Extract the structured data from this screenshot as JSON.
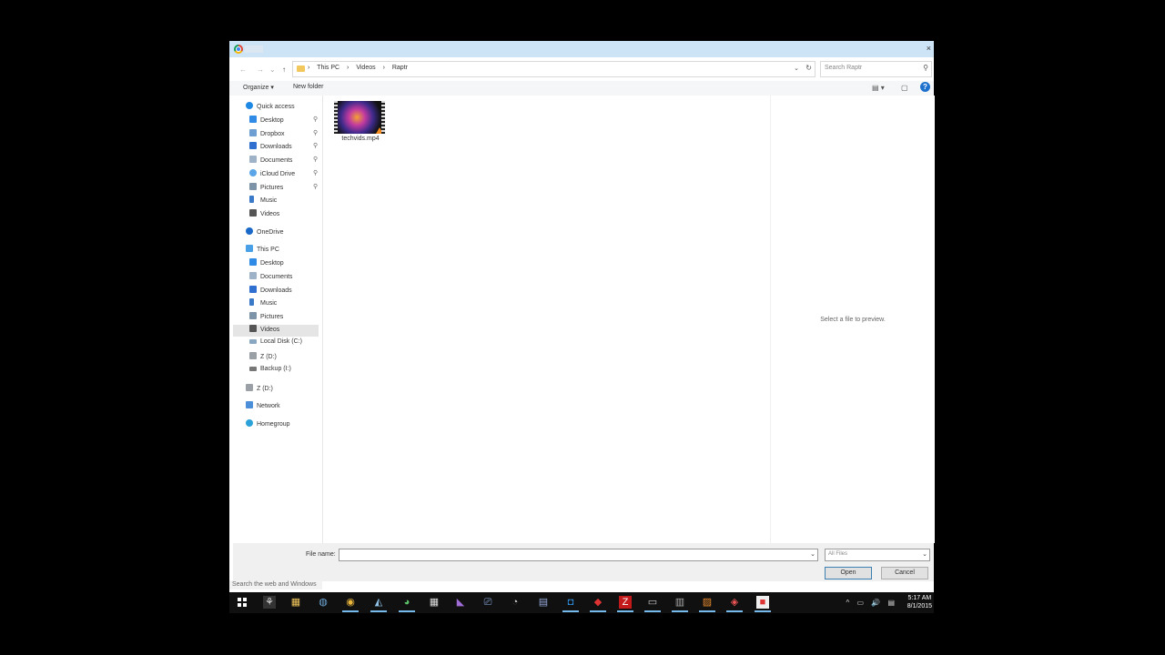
{
  "window": {
    "close_symbol": "×"
  },
  "address": {
    "back": "←",
    "forward": "→",
    "recent": "⌄",
    "up": "↑",
    "crumbs": [
      "›",
      "This PC",
      "›",
      "Videos",
      "›",
      "Raptr"
    ],
    "search_placeholder": "Search Raptr"
  },
  "toolbar": {
    "organize": "Organize ▾",
    "new_folder": "New folder",
    "help": "?"
  },
  "nav": {
    "quick_access": "Quick access",
    "qa_items": [
      "Desktop",
      "Dropbox",
      "Downloads",
      "Documents",
      "iCloud Drive",
      "Pictures",
      "Music",
      "Videos"
    ],
    "onedrive": "OneDrive",
    "this_pc": "This PC",
    "pc_items": [
      "Desktop",
      "Documents",
      "Downloads",
      "Music",
      "Pictures",
      "Videos",
      "Local Disk (C:)",
      "Z (D:)",
      "Backup (I:)"
    ],
    "z_drive": "Z (D:)",
    "network": "Network",
    "homegroup": "Homegroup",
    "pin_symbol": "📌"
  },
  "files": [
    {
      "name": "techvids.mp4"
    }
  ],
  "preview": {
    "message": "Select a file to preview."
  },
  "bottom": {
    "file_name_label": "File name:",
    "file_name_value": "",
    "filter": "All Files",
    "open": "Open",
    "cancel": "Cancel"
  },
  "taskbar": {
    "search_text": "Search the web and Windows",
    "time": "5:17 AM",
    "date": "8/1/2015",
    "tray": "^ ▭ 🔊 ▤"
  }
}
